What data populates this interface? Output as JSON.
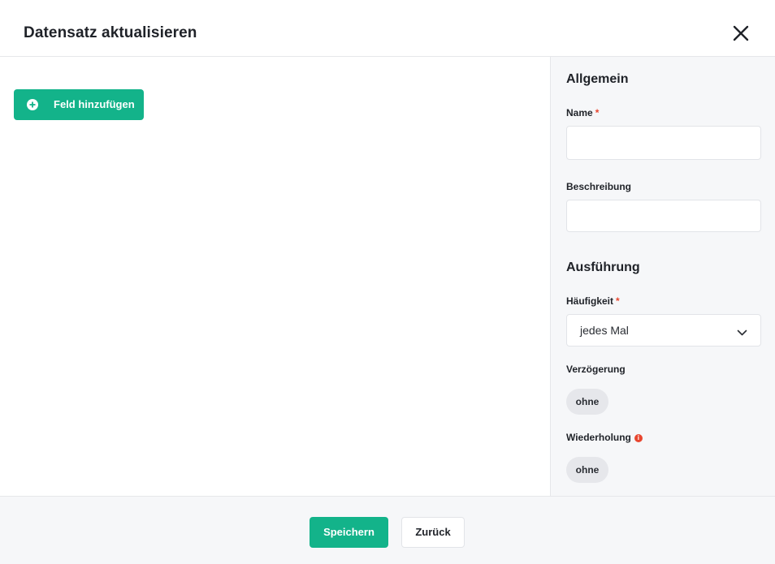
{
  "dialog": {
    "title": "Datensatz aktualisieren",
    "close_icon": "close-icon"
  },
  "main": {
    "add_field_label": "Feld hinzufügen",
    "add_field_icon": "plus-circle-icon"
  },
  "sidebar": {
    "general_title": "Allgemein",
    "name_label": "Name",
    "name_required": "*",
    "name_value": "",
    "description_label": "Beschreibung",
    "description_value": "",
    "execution_title": "Ausführung",
    "frequency_label": "Häufigkeit",
    "frequency_required": "*",
    "frequency_value": "jedes Mal",
    "delay_label": "Verzögerung",
    "delay_value": "ohne",
    "repeat_label": "Wiederholung",
    "repeat_info_icon": "info-icon",
    "repeat_value": "ohne"
  },
  "footer": {
    "save_label": "Speichern",
    "back_label": "Zurück"
  },
  "colors": {
    "accent": "#13b38a",
    "required": "#e8462f",
    "panel_bg": "#f6f7f9"
  }
}
